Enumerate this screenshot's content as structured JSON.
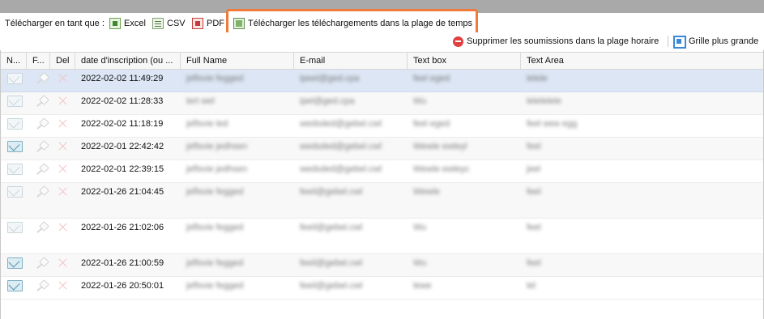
{
  "toolbar": {
    "download_as_label": "Télécharger en tant que :",
    "excel_label": "Excel",
    "csv_label": "CSV",
    "pdf_label": "PDF",
    "download_range_label": "Télécharger les téléchargements dans la plage de temps",
    "delete_range_label": "Supprimer les soumissions dans la plage horaire",
    "larger_grid_label": "Grille plus grande"
  },
  "colors": {
    "highlight": "#ef7a3a",
    "selected_row": "#dce6f4",
    "header_bg": "#f7f7f7"
  },
  "grid": {
    "columns": [
      "N...",
      "F...",
      "Del",
      "date d'inscription (ou ...",
      "Full Name",
      "E-mail",
      "Text box",
      "Text Area"
    ],
    "rows": [
      {
        "date": "2022-02-02 11:49:29",
        "name": "jeflsvie fegged",
        "email": "ipeel@ged.cpa",
        "textbox": "feel eged",
        "textarea": "lelele",
        "read": false
      },
      {
        "date": "2022-02-02 11:28:33",
        "name": "lert wel",
        "email": "ipel@ged.cpa",
        "textbox": "Wu",
        "textarea": "lelelelele",
        "read": false
      },
      {
        "date": "2022-02-02 11:18:19",
        "name": "jeflsvie led",
        "email": "wedsded@gebel.cwl",
        "textbox": "feel eged",
        "textarea": "feel eew egg",
        "read": false
      },
      {
        "date": "2022-02-01 22:42:42",
        "name": "jeflsvie jedhsen",
        "email": "wedsded@gebel.cwl",
        "textbox": "Wewle ewleyl",
        "textarea": "feel",
        "read": true
      },
      {
        "date": "2022-02-01 22:39:15",
        "name": "jeflsvie jedhsen",
        "email": "wedsded@gebel.cwl",
        "textbox": "Wewle ewleyc",
        "textarea": "jeel",
        "read": false
      },
      {
        "date": "2022-01-26 21:04:45",
        "name": "jeflsvie fegged",
        "email": "feeil@gebel.cwl",
        "textbox": "Wewle",
        "textarea": "feel",
        "read": false
      },
      {
        "date": "2022-01-26 21:02:06",
        "name": "jeflsvie fegged",
        "email": "feeil@gebel.cwl",
        "textbox": "Wu",
        "textarea": "feel",
        "read": false
      },
      {
        "date": "2022-01-26 21:00:59",
        "name": "jeflsvie fegged",
        "email": "feeil@gebel.cwl",
        "textbox": "Wu",
        "textarea": "feel",
        "read": true
      },
      {
        "date": "2022-01-26 20:50:01",
        "name": "jeflsvie fegged",
        "email": "feeil@gebel.cwl",
        "textbox": "lewe",
        "textarea": "lel",
        "read": true
      }
    ]
  }
}
